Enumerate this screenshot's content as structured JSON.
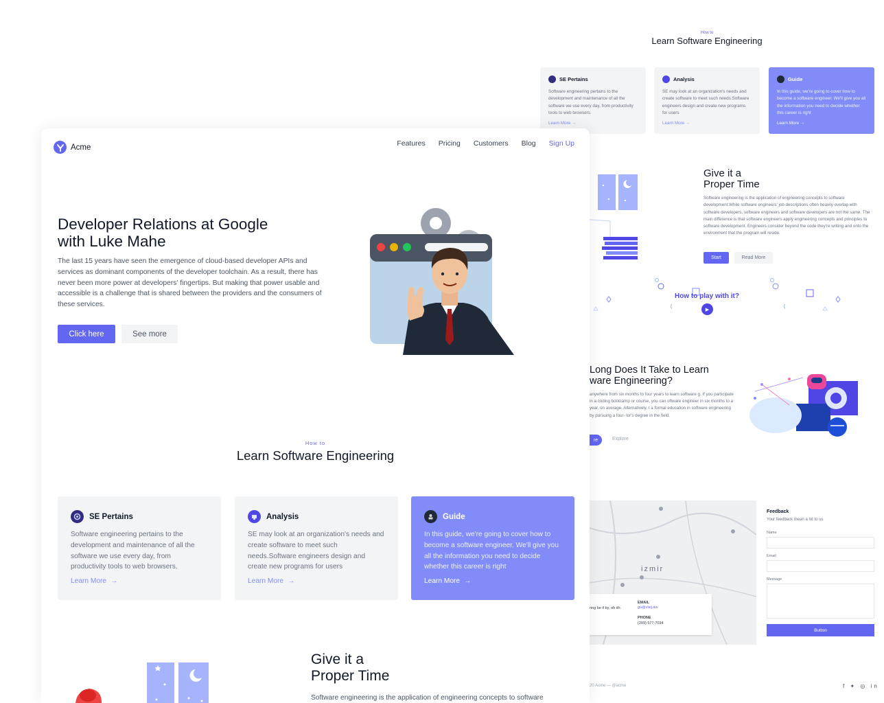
{
  "back": {
    "eyebrow": "How to",
    "title": "Learn Software Engineering",
    "cards": [
      {
        "title": "SE Pertains",
        "body": "Software engineering pertains to the development and maintenance of all the software we use every day, from productivity tools to web browsers.",
        "link": "Learn More"
      },
      {
        "title": "Analysis",
        "body": "SE may look at an organization's needs and create software to meet such needs.Software engineers design and create new programs for users",
        "link": "Learn More"
      },
      {
        "title": "Guide",
        "body": "In this guide, we're going to cover how to become a software engineer. We'll give you all the information you need to decide whether this career is right",
        "link": "Learn More"
      }
    ],
    "give_title_1": "Give it a",
    "give_title_2": "Proper Time",
    "give_body": "Software engineering is the application of engineering concepts to software development.While software engineers' job descriptions often heavily overlap with software developers, software engineers and software developers are not the same. The main difference is that software engineers apply engineering concepts and principles to software development. Engineers consider beyond the code they're writing and onto the environment that the program will reside.",
    "start_label": "Start",
    "read_more_label": "Read More",
    "play_text": "How to play with it?",
    "long_title_1": "Long Does It Take to Learn",
    "long_title_2": "ware Engineering?",
    "long_body": "anywhere from six months to four years to learn software g. If you participate in a coding bootcamp or course, you can oftware engineer in six months to a year, on average. Alternatively, t a formal education in software engineering by pursuing a four- lor's degree in the field.",
    "long_btn": "re",
    "explore_label": "Explore",
    "map_city": "izmir",
    "map_card_text": "ring be if by, oh ith.",
    "email_label": "EMAIL",
    "email_value": "gu@visij.aw",
    "phone_label": "PHONE",
    "phone_value": "(209) 577-7034",
    "feedback_title": "Feedback",
    "feedback_sub": "Your feedback mean a lot to us",
    "name_label": "Name",
    "email_field_label": "Email",
    "message_label": "Message",
    "button_label": "Button",
    "footer_text": "20 Acme — @acme",
    "social": "f ✦ ◎ in"
  },
  "front": {
    "brand": "Acme",
    "nav": [
      "Features",
      "Pricing",
      "Customers",
      "Blog"
    ],
    "signup": "Sign Up",
    "hero_title_1": "Developer Relations at Google",
    "hero_title_2": "with Luke Mahe",
    "hero_body": "The last 15 years have seen the emergence of cloud-based developer APIs and services as dominant components of the developer toolchain. As a result, there has never been more power at developers' fingertips. But making that power usable and accessible is a challenge that is shared between the providers and the consumers of these services.",
    "primary_btn": "Click here",
    "secondary_btn": "See more",
    "section_eyebrow": "How to",
    "section_title": "Learn Software Engineering",
    "cards": [
      {
        "title": "SE Pertains",
        "body": "Software engineering pertains to the development and maintenance of all the software we use every day, from productivity tools to web browsers.",
        "link": "Learn More"
      },
      {
        "title": "Analysis",
        "body": "SE may look at an organization's needs and create software to meet such needs.Software engineers design and create new programs for users",
        "link": "Learn More"
      },
      {
        "title": "Guide",
        "body": "In this guide, we're going to cover how to become a software engineer. We'll give you all the information you need to decide whether this career is right",
        "link": "Learn More"
      }
    ],
    "give_title_1": "Give it a",
    "give_title_2": "Proper Time",
    "give_body": "Software engineering is the application of engineering concepts to software"
  },
  "colors": {
    "accent": "#6366f1",
    "accent_light": "#818cf8",
    "card_bg": "#f3f4f6",
    "text_dark": "#111827",
    "text_muted": "#6b7280"
  }
}
